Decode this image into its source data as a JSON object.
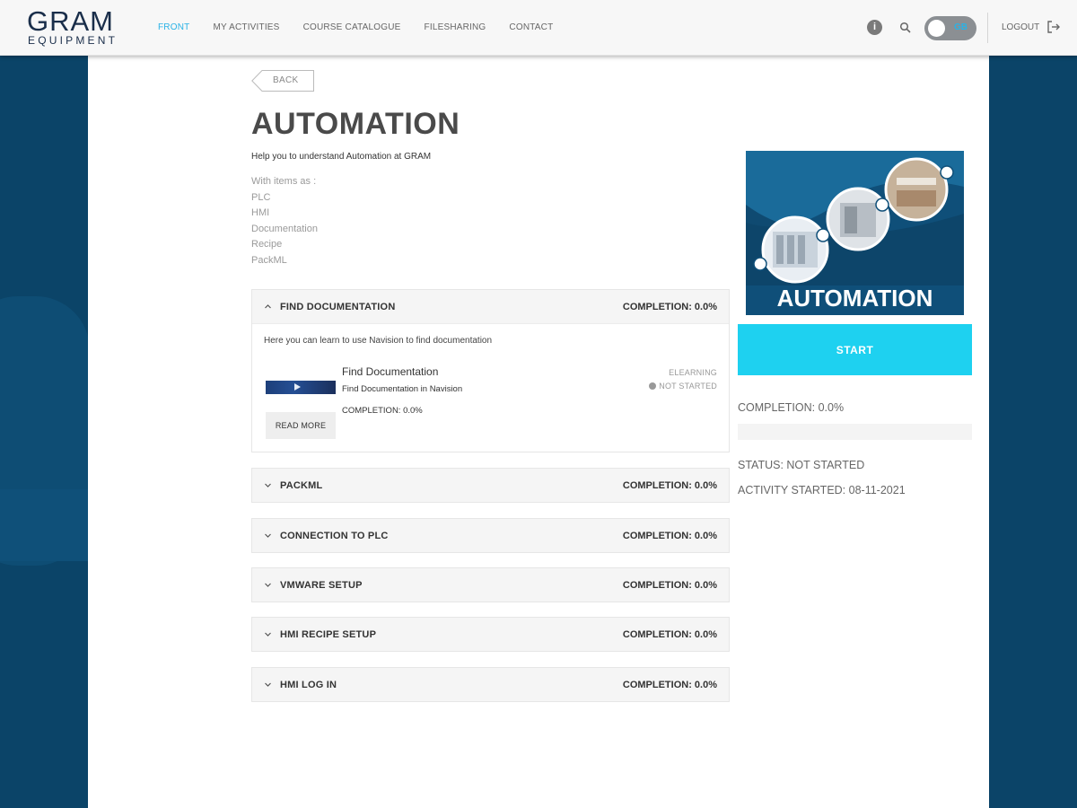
{
  "logo": {
    "main": "GRAM",
    "sub": "EQUIPMENT"
  },
  "nav": {
    "items": [
      {
        "label": "FRONT",
        "active": true
      },
      {
        "label": "MY ACTIVITIES",
        "active": false
      },
      {
        "label": "COURSE CATALOGUE",
        "active": false
      },
      {
        "label": "FILESHARING",
        "active": false
      },
      {
        "label": "CONTACT",
        "active": false
      }
    ]
  },
  "header": {
    "info_icon": "info-icon",
    "search_icon": "search-icon",
    "language_toggle": "GB",
    "logout_label": "LOGOUT",
    "logout_icon": "logout-icon"
  },
  "page": {
    "back_label": "BACK",
    "title": "AUTOMATION",
    "subtitle": "Help you to understand Automation at GRAM",
    "description": [
      "With items as :",
      "PLC",
      "HMI",
      "Documentation",
      "Recipe",
      "PackML"
    ]
  },
  "sections": [
    {
      "title": "FIND DOCUMENTATION",
      "completion": "COMPLETION: 0.0%",
      "expanded": true,
      "body_text": "Here you can learn to use Navision to find documentation",
      "item": {
        "title": "Find Documentation",
        "subtitle": "Find Documentation in Navision",
        "completion": "COMPLETION: 0.0%",
        "type": "ELEARNING",
        "status": "NOT STARTED",
        "read_more": "READ MORE"
      }
    },
    {
      "title": "PACKML",
      "completion": "COMPLETION: 0.0%",
      "expanded": false
    },
    {
      "title": "CONNECTION TO PLC",
      "completion": "COMPLETION: 0.0%",
      "expanded": false
    },
    {
      "title": "VMWARE SETUP",
      "completion": "COMPLETION: 0.0%",
      "expanded": false
    },
    {
      "title": "HMI RECIPE SETUP",
      "completion": "COMPLETION: 0.0%",
      "expanded": false
    },
    {
      "title": "HMI LOG IN",
      "completion": "COMPLETION: 0.0%",
      "expanded": false
    }
  ],
  "sidebar": {
    "image_label": "AUTOMATION",
    "start_label": "START",
    "completion": "COMPLETION: 0.0%",
    "progress_percent": 0,
    "status": "STATUS: NOT STARTED",
    "activity_started": "ACTIVITY STARTED: 08-11-2021"
  },
  "colors": {
    "accent": "#1ed1f0",
    "nav_active": "#2ab2e6",
    "background": "#0b4468",
    "logo": "#1a2e4a"
  }
}
